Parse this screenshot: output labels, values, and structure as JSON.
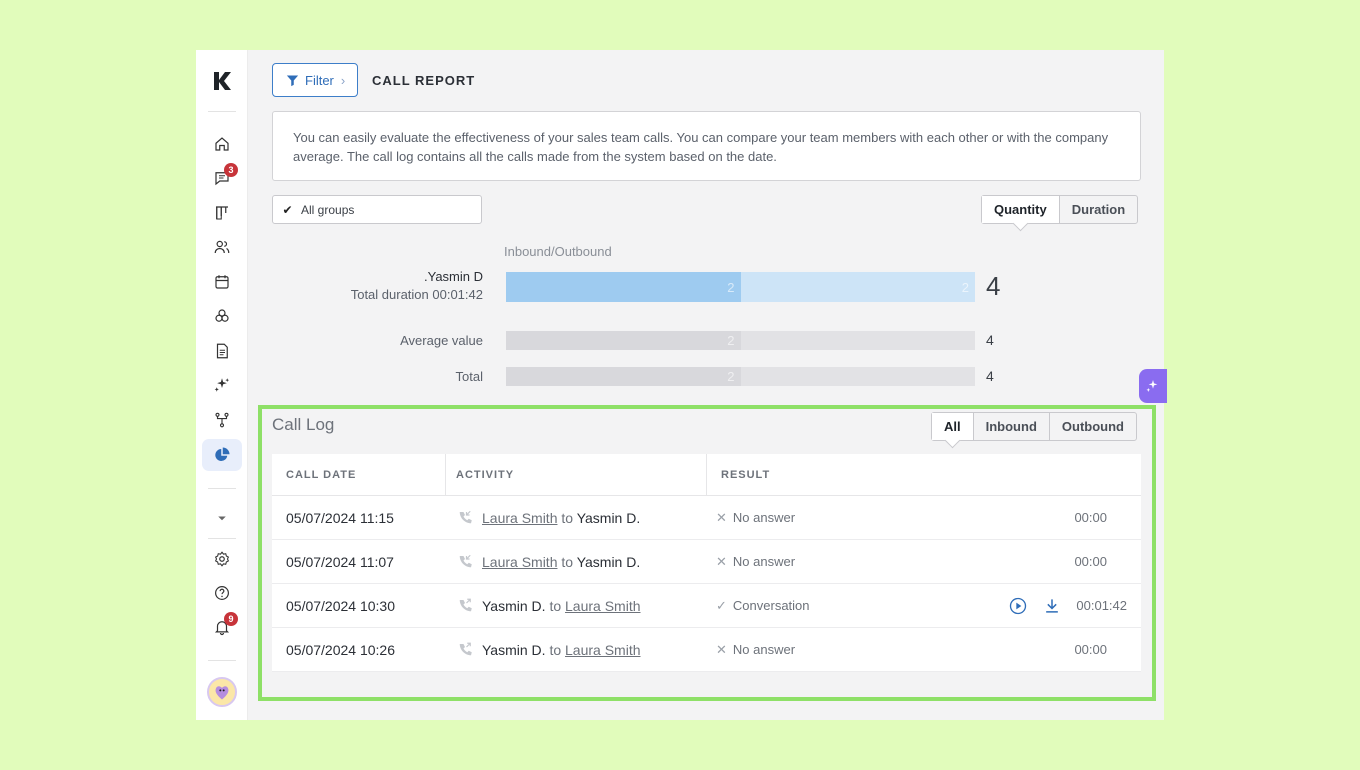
{
  "sidebar": {
    "badges": {
      "messages": "3",
      "notifications": "9"
    }
  },
  "header": {
    "filter_label": "Filter",
    "title": "CALL REPORT"
  },
  "info_text": "You can easily evaluate the effectiveness of your sales team calls. You can compare your team members with each other or with the company average. The call log contains all the calls made from the system based on the date.",
  "groups_filter": {
    "label": "All groups",
    "checked": true
  },
  "mode_toggle": {
    "options": [
      "Quantity",
      "Duration"
    ],
    "selected": "Quantity"
  },
  "chart": {
    "caption": "Inbound/Outbound",
    "rows": [
      {
        "name": ".Yasmin D",
        "sub": "Total duration 00:01:42",
        "inbound": "2",
        "outbound": "2",
        "total": "4"
      },
      {
        "name": "Average value",
        "inbound": "2",
        "outbound": "",
        "total": "4"
      },
      {
        "name": "Total",
        "inbound": "2",
        "outbound": "",
        "total": "4"
      }
    ],
    "colors": {
      "inbound": "#9ecbf0",
      "outbound": "#cde4f7",
      "gray_in": "#d8d8dc",
      "gray_out": "#e2e2e5"
    }
  },
  "call_log": {
    "title": "Call Log",
    "filters": [
      "All",
      "Inbound",
      "Outbound"
    ],
    "selected_filter": "All",
    "columns": [
      "CALL DATE",
      "ACTIVITY",
      "RESULT"
    ],
    "rows": [
      {
        "date": "05/07/2024 11:15",
        "direction": "inbound",
        "from": "Laura Smith",
        "to_word": "to",
        "to": "Yasmin D.",
        "result": "No answer",
        "result_icon": "x-icon",
        "duration": "00:00"
      },
      {
        "date": "05/07/2024 11:07",
        "direction": "inbound",
        "from": "Laura Smith",
        "to_word": "to",
        "to": "Yasmin D.",
        "result": "No answer",
        "result_icon": "x-icon",
        "duration": "00:00"
      },
      {
        "date": "05/07/2024 10:30",
        "direction": "outbound",
        "from": "Yasmin D.",
        "to_word": "to",
        "to": "Laura Smith",
        "result": "Conversation",
        "result_icon": "check-icon",
        "duration": "00:01:42",
        "has_recording": true
      },
      {
        "date": "05/07/2024 10:26",
        "direction": "outbound",
        "from": "Yasmin D.",
        "to_word": "to",
        "to": "Laura Smith",
        "result": "No answer",
        "result_icon": "x-icon",
        "duration": "00:00"
      }
    ]
  }
}
